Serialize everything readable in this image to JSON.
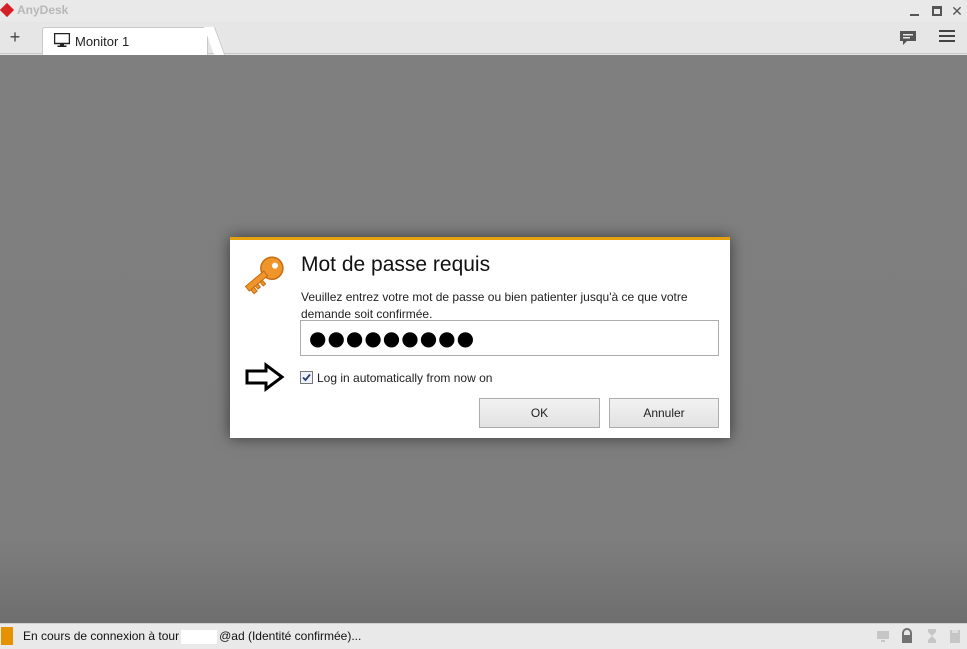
{
  "window": {
    "app_title": "AnyDesk",
    "min_icon": "minimize-icon",
    "max_icon": "maximize-icon",
    "close_glyph": "✕"
  },
  "tabs": {
    "add_glyph": "+",
    "items": [
      {
        "label": "Monitor 1",
        "icon": "monitor-icon"
      }
    ],
    "right_icons": [
      "chat-icon",
      "hamburger-menu-icon"
    ]
  },
  "dialog": {
    "title": "Mot de passe requis",
    "message": "Veuillez entrez votre mot de passe ou bien patienter jusqu'à ce que votre demande soit confirmée.",
    "password_value": "●●●●●●●●●",
    "auto_login_label": "Log in automatically from now on",
    "auto_login_checked": true,
    "ok_label": "OK",
    "cancel_label": "Annuler",
    "accent_color": "#e6a20c",
    "icon": "key-icon"
  },
  "status": {
    "text_before": "En cours de connexion à tour",
    "text_after": "@ad (Identité confirmée)...",
    "icons": [
      "hourglass-icon",
      "monitor-status-icon",
      "lock-icon",
      "hourglass-status-icon",
      "disk-icon"
    ]
  }
}
